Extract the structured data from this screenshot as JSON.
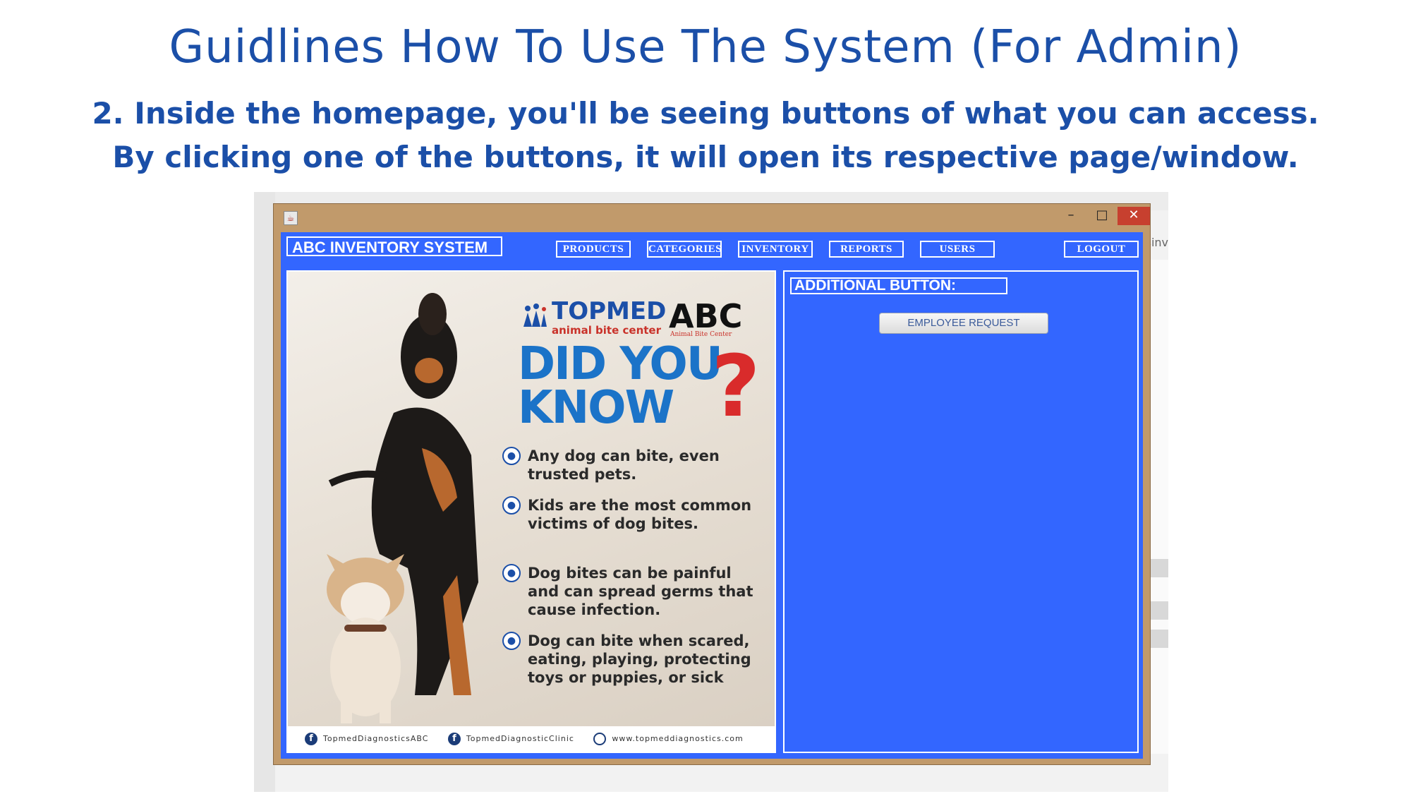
{
  "slide": {
    "title": "Guidlines  How To Use The System (For Admin)",
    "subtitle_line1": "2. Inside the homepage, you'll be seeing buttons of what you can access.",
    "subtitle_line2": "By clicking one of the buttons, it will open its respective page/window."
  },
  "background_ide": {
    "edge_text": "sinv"
  },
  "window": {
    "min_label": "–",
    "max_label": "□",
    "close_label": "✕"
  },
  "app": {
    "brand": "ABC INVENTORY SYSTEM",
    "nav": [
      "PRODUCTS",
      "CATEGORIES",
      "INVENTORY",
      "REPORTS",
      "USERS"
    ],
    "logout": "LOGOUT",
    "additional_label": "ADDITIONAL BUTTON:",
    "employee_request": "EMPLOYEE REQUEST",
    "accent_color": "#3366ff"
  },
  "poster": {
    "topmed": "TOPMED",
    "topmed_tag": "animal bite center",
    "abc": "ABC",
    "abc_sub": "Animal Bite Center",
    "did_you": "DID YOU",
    "know": "KNOW",
    "qmark": "?",
    "facts": [
      "Any dog can bite, even trusted pets.",
      "Kids are the most common victims of dog bites.",
      "Dog bites can be painful and can spread germs that cause infection.",
      "Dog can bite when scared, eating, playing, protecting toys or puppies, or sick"
    ],
    "footer": [
      "TopmedDiagnosticsABC",
      "TopmedDiagnosticClinic",
      "www.topmeddiagnostics.com"
    ]
  }
}
